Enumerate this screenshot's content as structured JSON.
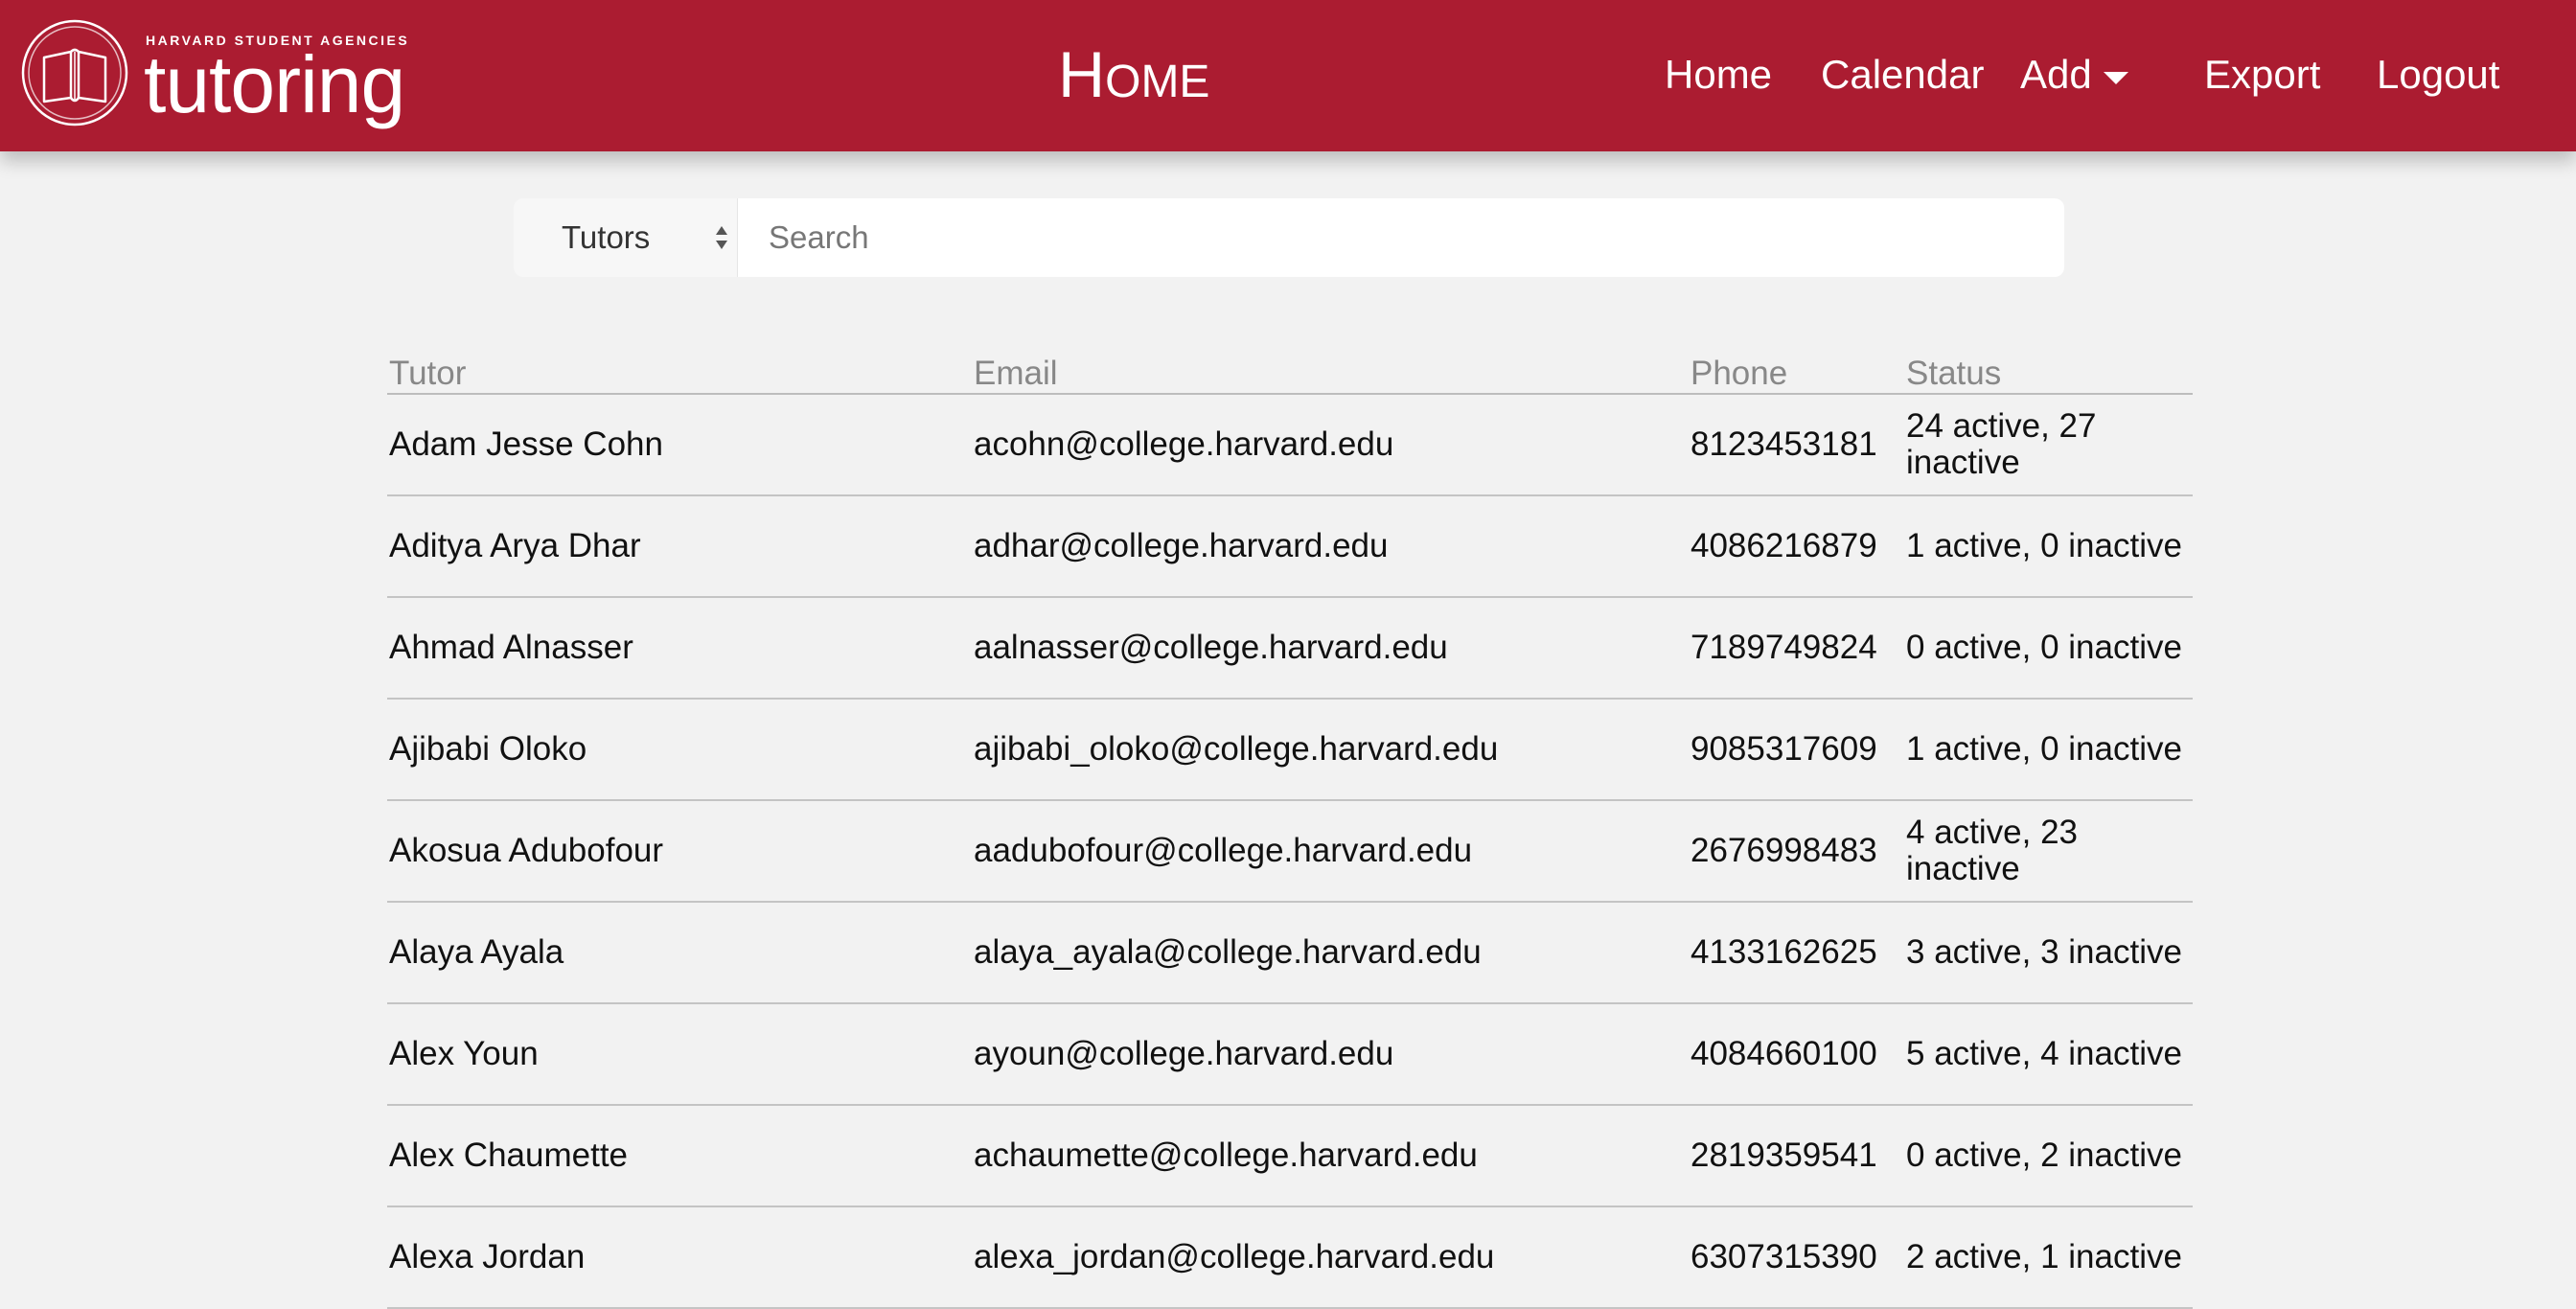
{
  "header": {
    "logo_top": "HARVARD STUDENT AGENCIES",
    "logo_word": "tutoring",
    "page_title": "Home",
    "nav": {
      "home": "Home",
      "calendar": "Calendar",
      "add": "Add",
      "export": "Export",
      "logout": "Logout"
    }
  },
  "search": {
    "type_selected": "Tutors",
    "placeholder": "Search",
    "value": ""
  },
  "table": {
    "headers": {
      "tutor": "Tutor",
      "email": "Email",
      "phone": "Phone",
      "status": "Status"
    },
    "rows": [
      {
        "name": "Adam Jesse Cohn",
        "email": "acohn@college.harvard.edu",
        "phone": "8123453181",
        "status": "24 active, 27 inactive"
      },
      {
        "name": "Aditya Arya Dhar",
        "email": "adhar@college.harvard.edu",
        "phone": "4086216879",
        "status": "1 active, 0 inactive"
      },
      {
        "name": "Ahmad Alnasser",
        "email": "aalnasser@college.harvard.edu",
        "phone": "7189749824",
        "status": "0 active, 0 inactive"
      },
      {
        "name": "Ajibabi Oloko",
        "email": "ajibabi_oloko@college.harvard.edu",
        "phone": "9085317609",
        "status": "1 active, 0 inactive"
      },
      {
        "name": "Akosua Adubofour",
        "email": "aadubofour@college.harvard.edu",
        "phone": "2676998483",
        "status": "4 active, 23 inactive"
      },
      {
        "name": "Alaya Ayala",
        "email": "alaya_ayala@college.harvard.edu",
        "phone": "4133162625",
        "status": "3 active, 3 inactive"
      },
      {
        "name": "Alex Youn",
        "email": "ayoun@college.harvard.edu",
        "phone": "4084660100",
        "status": "5 active, 4 inactive"
      },
      {
        "name": "Alex Chaumette",
        "email": "achaumette@college.harvard.edu",
        "phone": "2819359541",
        "status": "0 active, 2 inactive"
      },
      {
        "name": "Alexa Jordan",
        "email": "alexa_jordan@college.harvard.edu",
        "phone": "6307315390",
        "status": "2 active, 1 inactive"
      }
    ]
  },
  "colors": {
    "header_bg": "#ab1c31",
    "page_bg": "#f2f2f2",
    "header_text": "#ffffff"
  },
  "icons": {
    "logo": "open-book-seal-icon",
    "add_caret": "caret-down-icon",
    "select_arrows": "select-updown-icon"
  }
}
